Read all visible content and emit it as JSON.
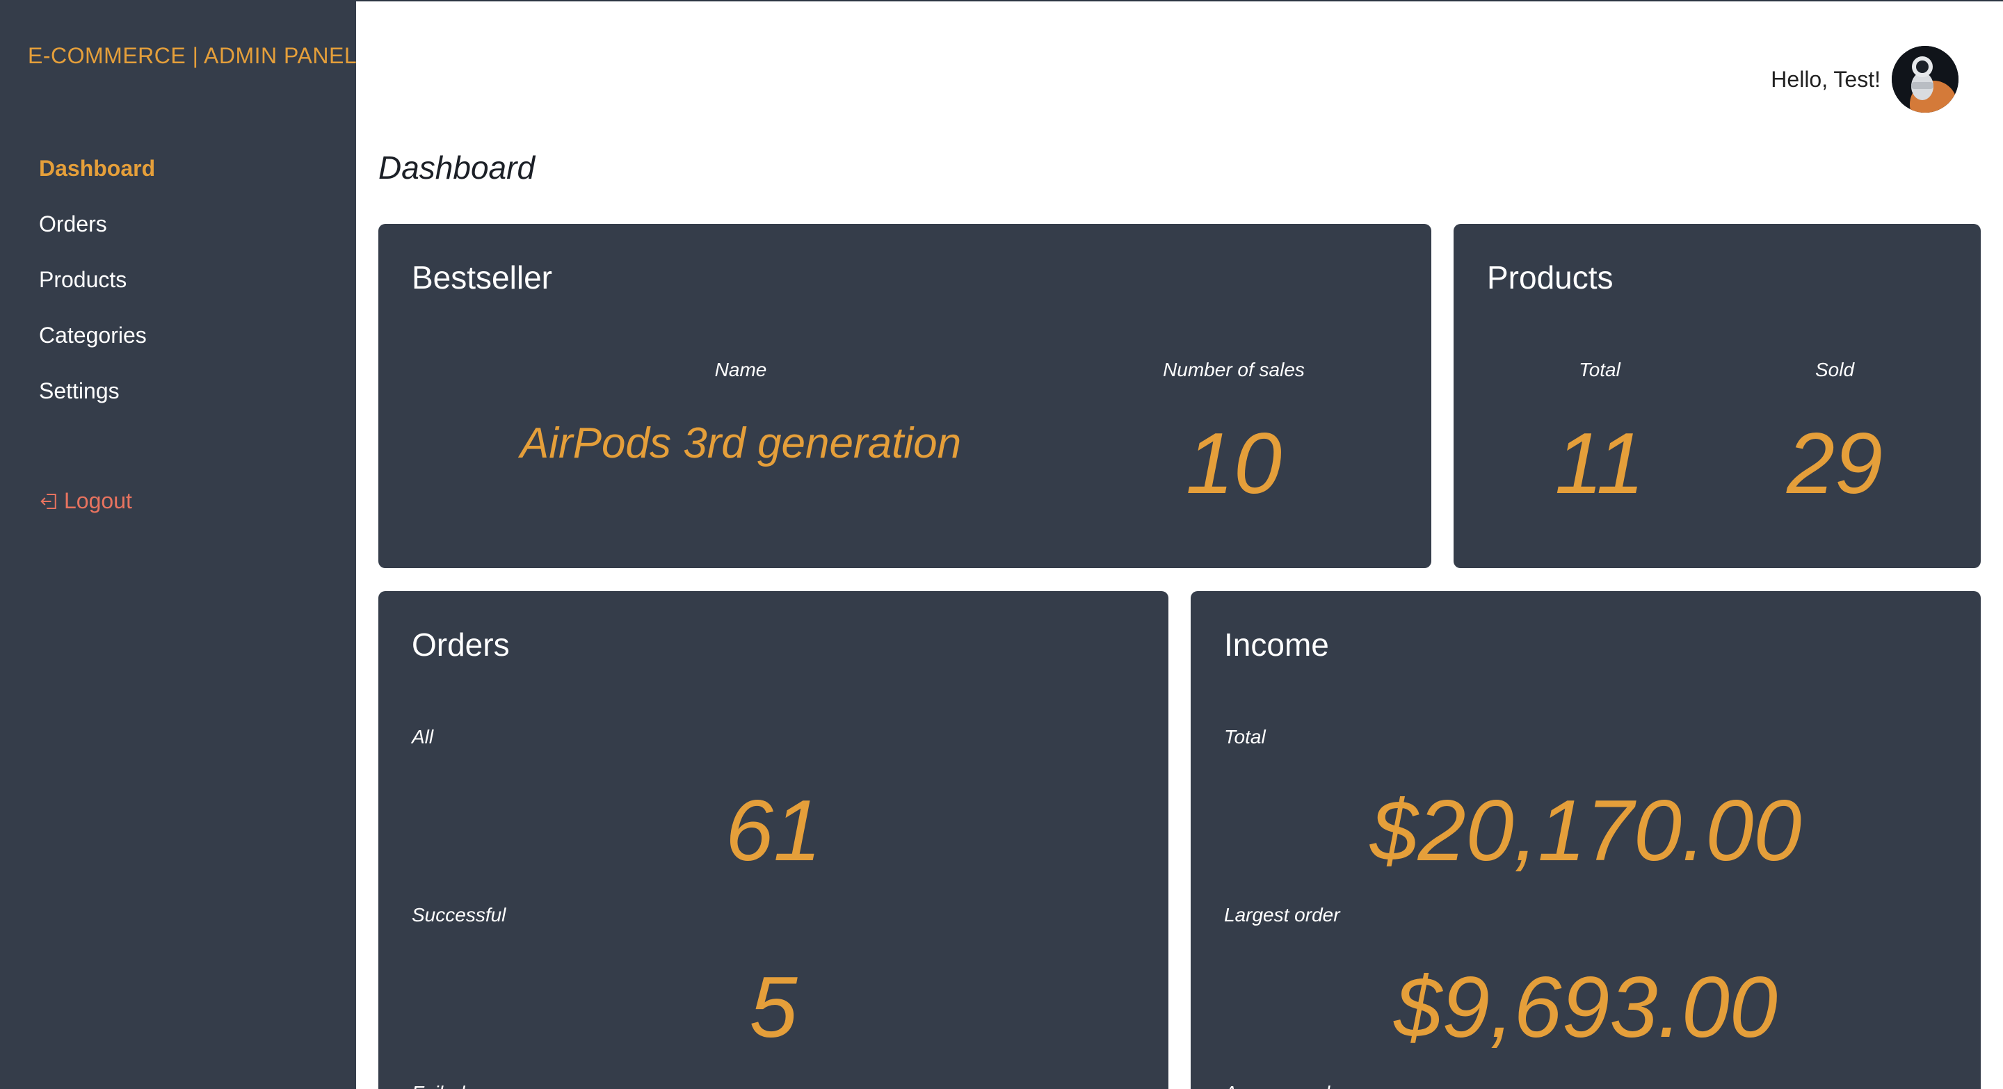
{
  "sidebar": {
    "brand": "E-COMMERCE | ADMIN PANEL",
    "items": [
      {
        "label": "Dashboard",
        "active": true
      },
      {
        "label": "Orders"
      },
      {
        "label": "Products"
      },
      {
        "label": "Categories"
      },
      {
        "label": "Settings"
      }
    ],
    "logout_label": "Logout"
  },
  "header": {
    "greeting": "Hello, Test!",
    "avatar_icon": "astronaut-avatar"
  },
  "page_title": "Dashboard",
  "bestseller": {
    "title": "Bestseller",
    "name_label": "Name",
    "sales_label": "Number of sales",
    "name_value": "AirPods 3rd generation",
    "sales_value": "10"
  },
  "products": {
    "title": "Products",
    "total_label": "Total",
    "sold_label": "Sold",
    "total_value": "11",
    "sold_value": "29"
  },
  "orders": {
    "title": "Orders",
    "all_label": "All",
    "all_value": "61",
    "successful_label": "Successful",
    "successful_value": "5",
    "failed_label": "Failed"
  },
  "income": {
    "title": "Income",
    "total_label": "Total",
    "total_value": "$20,170.00",
    "largest_label": "Largest order",
    "largest_value": "$9,693.00",
    "average_label": "Average order"
  },
  "colors": {
    "accent": "#e59f3a",
    "sidebar_bg": "#353d4a",
    "card_bg": "#353d4a",
    "logout": "#e8735f"
  }
}
